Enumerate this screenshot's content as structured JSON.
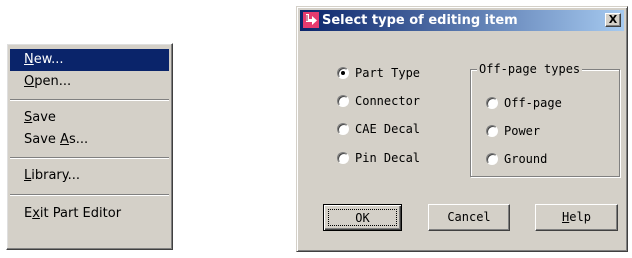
{
  "menu": {
    "items": [
      {
        "pre": "",
        "key": "N",
        "post": "ew...",
        "selected": true
      },
      {
        "pre": "",
        "key": "O",
        "post": "pen...",
        "selected": false
      },
      {
        "pre": "",
        "key": "S",
        "post": "ave",
        "selected": false
      },
      {
        "pre": "Save ",
        "key": "A",
        "post": "s...",
        "selected": false
      },
      {
        "pre": "",
        "key": "L",
        "post": "ibrary...",
        "selected": false
      },
      {
        "pre": "E",
        "key": "x",
        "post": "it Part Editor",
        "selected": false
      }
    ]
  },
  "dialog": {
    "title": "Select type of editing item",
    "close_glyph": "X",
    "left_options": [
      {
        "label": "Part Type",
        "checked": true
      },
      {
        "label": "Connector",
        "checked": false
      },
      {
        "label": "CAE Decal",
        "checked": false
      },
      {
        "label": "Pin Decal",
        "checked": false
      }
    ],
    "group_title": "Off-page types",
    "group_options": [
      {
        "label": "Off-page",
        "checked": false
      },
      {
        "label": "Power",
        "checked": false
      },
      {
        "label": "Ground",
        "checked": false
      }
    ],
    "buttons": {
      "ok": "OK",
      "cancel": "Cancel",
      "help_key": "H",
      "help_rest": "elp"
    }
  }
}
